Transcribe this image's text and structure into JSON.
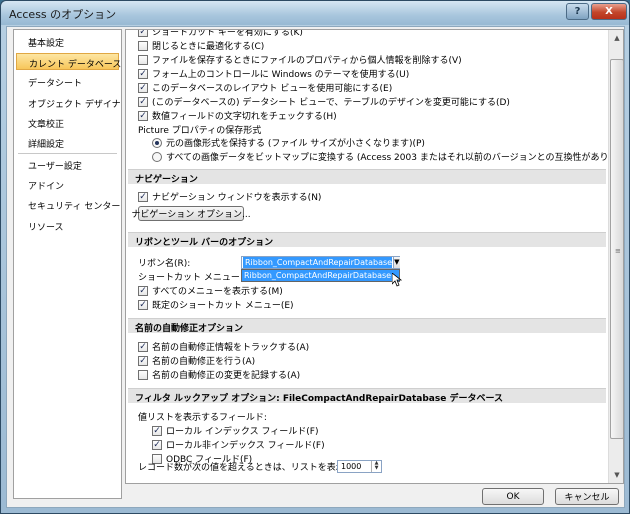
{
  "window": {
    "title": "Access のオプション",
    "help": "?",
    "close": "X"
  },
  "sidebar": {
    "items": [
      {
        "label": "基本設定"
      },
      {
        "label": "カレント データベース"
      },
      {
        "label": "データシート"
      },
      {
        "label": "オブジェクト デザイナ"
      },
      {
        "label": "文章校正"
      },
      {
        "label": "詳細設定"
      },
      {
        "label": "ユーザー設定"
      },
      {
        "label": "アドイン"
      },
      {
        "label": "セキュリティ センター"
      },
      {
        "label": "リソース"
      }
    ]
  },
  "content": {
    "app_options": [
      {
        "label": "ショートカット キーを有効にする(K)",
        "checked": true
      },
      {
        "label": "閉じるときに最適化する(C)",
        "checked": false
      },
      {
        "label": "ファイルを保存するときにファイルのプロパティから個人情報を削除する(V)",
        "checked": false
      },
      {
        "label": "フォーム上のコントロールに Windows のテーマを使用する(U)",
        "checked": true
      },
      {
        "label": "このデータベースのレイアウト ビューを使用可能にする(E)",
        "checked": true
      },
      {
        "label": "(このデータベースの) データシート ビューで、テーブルのデザインを変更可能にする(D)",
        "checked": true
      },
      {
        "label": "数値フィールドの文字切れをチェックする(H)",
        "checked": true
      }
    ],
    "picture_label": "Picture プロパティの保存形式",
    "picture_options": [
      {
        "label": "元の画像形式を保持する (ファイル サイズが小さくなります)(P)",
        "selected": true
      },
      {
        "label": "すべての画像データをビットマップに変換する (Access 2003 またはそれ以前のバージョンとの互換性があります)(Y)",
        "selected": false
      }
    ],
    "navigation": {
      "header": "ナビゲーション",
      "show_pane": "ナビゲーション ウィンドウを表示する(N)",
      "options_button": "ナビゲーション オプション..."
    },
    "ribbon": {
      "header": "リボンとツール バーのオプション",
      "ribbon_name_label": "リボン名(R):",
      "ribbon_name_value": "Ribbon_CompactAndRepairDatabase",
      "dropdown_option": "Ribbon_CompactAndRepairDatabase",
      "shortcut_menu_label": "ショートカット メニュー バー:",
      "show_all_menus": "すべてのメニューを表示する(M)",
      "default_shortcut": "既定のショートカット メニュー(E)"
    },
    "autocorrect": {
      "header": "名前の自動修正オプション",
      "items": [
        {
          "label": "名前の自動修正情報をトラックする(A)",
          "checked": true
        },
        {
          "label": "名前の自動修正を行う(A)",
          "checked": true
        },
        {
          "label": "名前の自動修正の変更を記録する(A)",
          "checked": false
        }
      ]
    },
    "filter": {
      "header": "フィルタ ルックアップ オプション: FileCompactAndRepairDatabase データベース",
      "show_list_label": "値リストを表示するフィールド:",
      "items": [
        {
          "label": "ローカル インデックス フィールド(F)",
          "checked": true
        },
        {
          "label": "ローカル非インデックス フィールド(F)",
          "checked": true
        },
        {
          "label": "ODBC フィールド(F)",
          "checked": false
        }
      ],
      "limit_label": "レコード数が次の値を超えるときは、リストを表示しない:",
      "limit_value": "1000"
    }
  },
  "footer": {
    "ok": "OK",
    "cancel": "キャンセル"
  },
  "colors": {
    "selected_nav": "#f7c65a",
    "highlight": "#3399ff",
    "close_button": "#c3462b"
  }
}
